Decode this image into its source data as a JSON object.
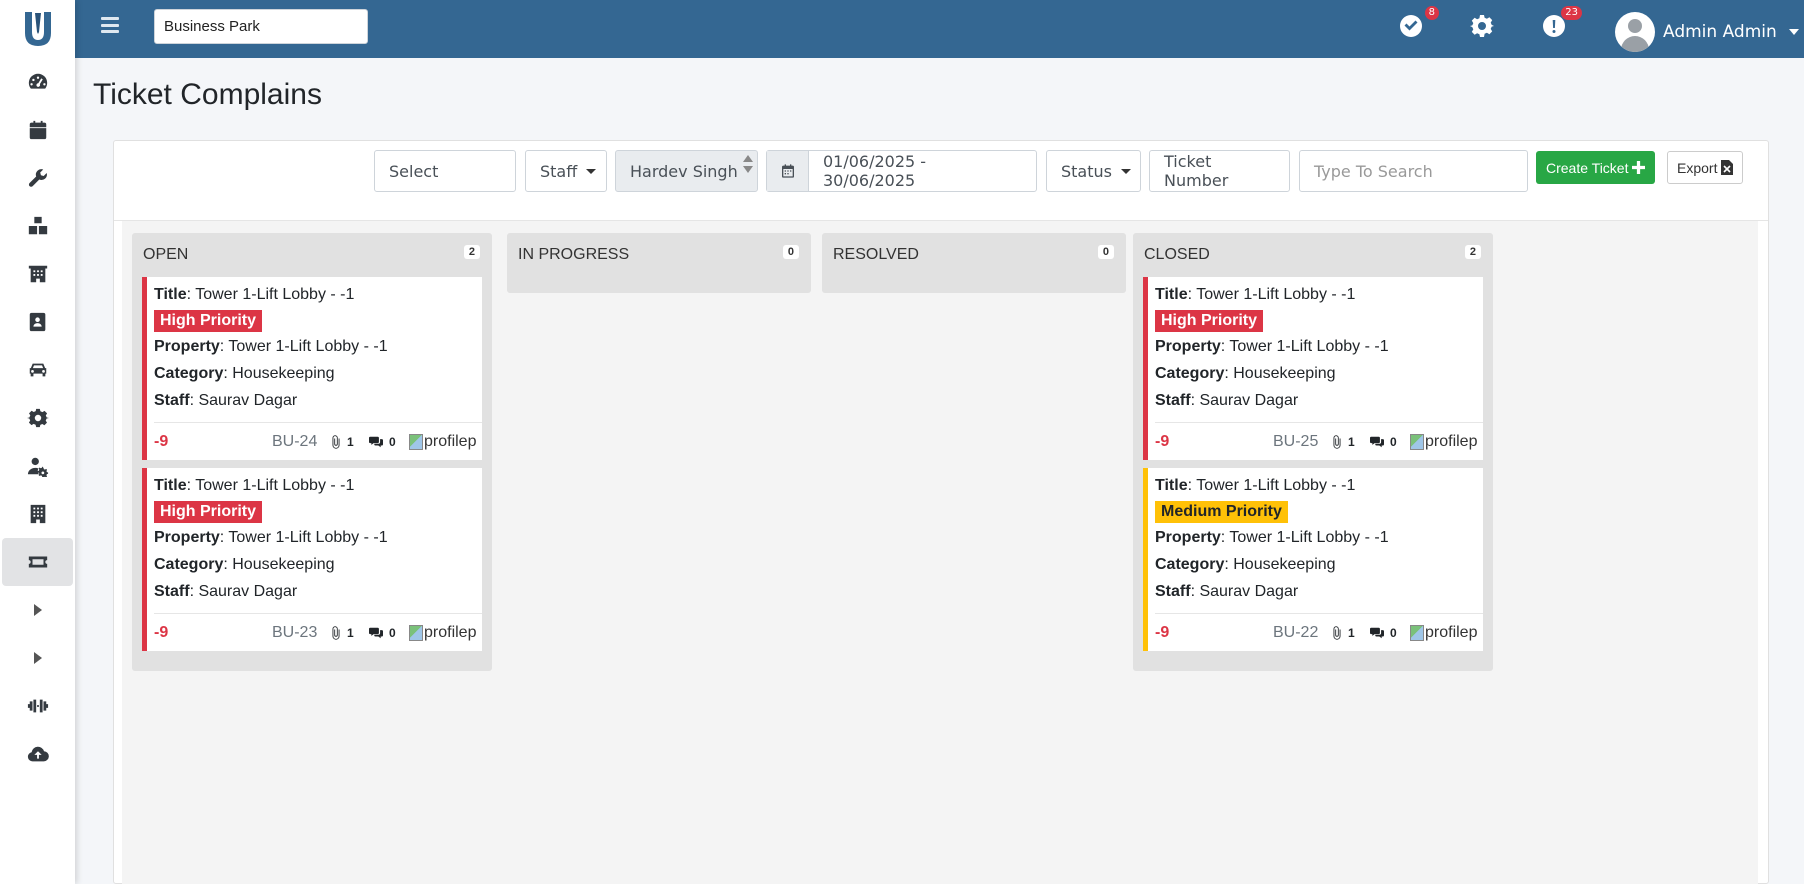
{
  "navbar": {
    "property_value": "Business Park",
    "tasks_badge": "8",
    "alerts_badge": "23",
    "user_name": "Admin Admin"
  },
  "page": {
    "title": "Ticket Complains"
  },
  "filters": {
    "select_label": "Select",
    "staff_label": "Staff",
    "staff_value": "Hardev Singh",
    "date_range": "01/06/2025 - 30/06/2025",
    "status_label": "Status",
    "ticket_number_placeholder": "Ticket Number",
    "search_placeholder": "Type To Search",
    "create_label": "Create Ticket",
    "export_label": "Export"
  },
  "labels": {
    "title": "Title",
    "property": "Property",
    "category": "Category",
    "staff": "Staff",
    "profile_alt": "profilep"
  },
  "columns": [
    {
      "name": "OPEN",
      "count": "2",
      "tickets": [
        {
          "title": "Tower 1-Lift Lobby - -1",
          "priority": "High Priority",
          "priority_color": "#dc3545",
          "property": "Tower 1-Lift Lobby - -1",
          "category": "Housekeeping",
          "staff": "Saurav Dagar",
          "days": "-9",
          "code": "BU-24",
          "attachments": "1",
          "comments": "0"
        },
        {
          "title": "Tower 1-Lift Lobby - -1",
          "priority": "High Priority",
          "priority_color": "#dc3545",
          "property": "Tower 1-Lift Lobby - -1",
          "category": "Housekeeping",
          "staff": "Saurav Dagar",
          "days": "-9",
          "code": "BU-23",
          "attachments": "1",
          "comments": "0"
        }
      ]
    },
    {
      "name": "IN PROGRESS",
      "count": "0",
      "tickets": []
    },
    {
      "name": "RESOLVED",
      "count": "0",
      "tickets": []
    },
    {
      "name": "CLOSED",
      "count": "2",
      "tickets": [
        {
          "title": "Tower 1-Lift Lobby - -1",
          "priority": "High Priority",
          "priority_color": "#dc3545",
          "property": "Tower 1-Lift Lobby - -1",
          "category": "Housekeeping",
          "staff": "Saurav Dagar",
          "days": "-9",
          "code": "BU-25",
          "attachments": "1",
          "comments": "0"
        },
        {
          "title": "Tower 1-Lift Lobby - -1",
          "priority": "Medium Priority",
          "priority_color": "#ffc107",
          "property": "Tower 1-Lift Lobby - -1",
          "category": "Housekeeping",
          "staff": "Saurav Dagar",
          "days": "-9",
          "code": "BU-22",
          "attachments": "1",
          "comments": "0"
        }
      ]
    }
  ],
  "colors": {
    "navbar": "#346792",
    "create_button": "#28a745",
    "high_priority": "#dc3545",
    "medium_priority": "#ffc107"
  }
}
